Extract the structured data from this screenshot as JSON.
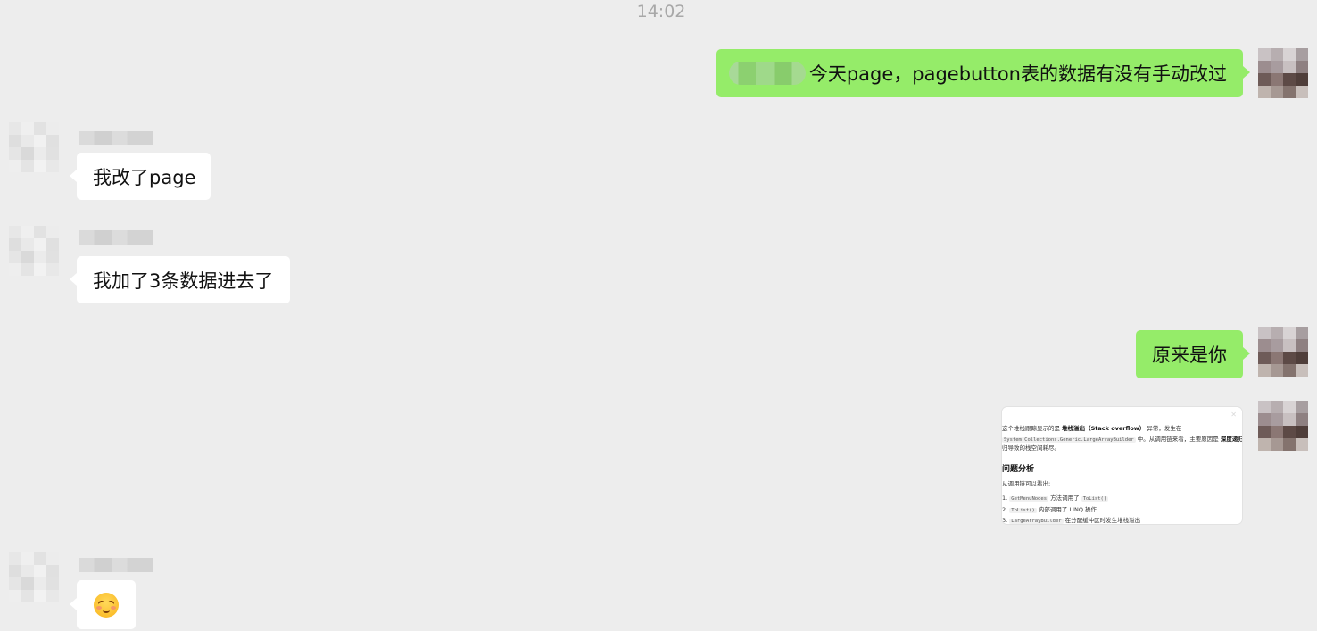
{
  "chat": {
    "timestamp": "14:02",
    "messages": [
      {
        "side": "right",
        "type": "text",
        "text": "今天page，pagebutton表的数据有没有手动改过"
      },
      {
        "side": "left",
        "type": "text",
        "text": "我改了page"
      },
      {
        "side": "left",
        "type": "text",
        "text": "我加了3条数据进去了"
      },
      {
        "side": "right",
        "type": "text",
        "text": "原来是你"
      },
      {
        "side": "right",
        "type": "image",
        "image": {
          "line1_a": "这个堆栈跟踪显示的是",
          "line1_b": "堆栈溢出（Stack overflow）",
          "line1_c": "异常，发生在",
          "line2_code": "System.Collections.Generic.LargeArrayBuilder",
          "line2_a": "中。从调用链来看，主要原因是",
          "line2_b": "深度递归调用或无限",
          "line3": "归导致的栈空间耗尽。",
          "heading": "问题分析",
          "intro": "从调用链可以看出:",
          "items": [
            {
              "num": "1.",
              "code": "GetMenuNodes",
              "text": "方法调用了",
              "code2": "ToList()"
            },
            {
              "num": "2.",
              "code": "ToList()",
              "text": "内部调用了 LINQ 操作",
              "code2": ""
            },
            {
              "num": "3.",
              "code": "LargeArrayBuilder",
              "text": "在分配缓冲区时发生堆栈溢出",
              "code2": ""
            }
          ]
        }
      },
      {
        "side": "left",
        "type": "emoji",
        "emoji": "blushing-face"
      }
    ]
  },
  "colors": {
    "background": "#ededed",
    "self_bubble": "#95ec69",
    "other_bubble": "#ffffff",
    "timestamp": "#a8a8a8"
  }
}
